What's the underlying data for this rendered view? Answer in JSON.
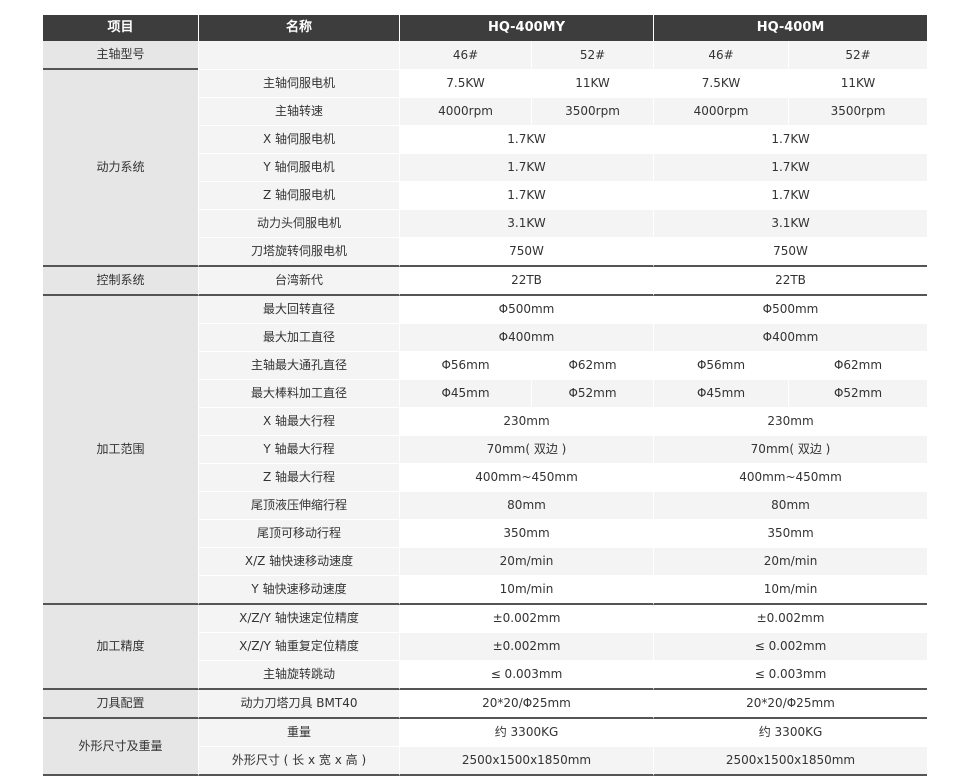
{
  "header": [
    "项目",
    "名称",
    "HQ-400MY",
    "HQ-400M"
  ],
  "spindle_model": {
    "label": "主轴型号",
    "values": [
      "46#",
      "52#",
      "46#",
      "52#"
    ]
  },
  "sections": [
    {
      "category": "动力系统",
      "rows": [
        {
          "name": "主轴伺服电机",
          "values": [
            "7.5KW",
            "11KW",
            "7.5KW",
            "11KW"
          ]
        },
        {
          "name": "主轴转速",
          "values": [
            "4000rpm",
            "3500rpm",
            "4000rpm",
            "3500rpm"
          ]
        },
        {
          "name": "X 轴伺服电机",
          "values": [
            "1.7KW",
            "1.7KW"
          ]
        },
        {
          "name": "Y 轴伺服电机",
          "values": [
            "1.7KW",
            "1.7KW"
          ]
        },
        {
          "name": "Z 轴伺服电机",
          "values": [
            "1.7KW",
            "1.7KW"
          ]
        },
        {
          "name": "动力头伺服电机",
          "values": [
            "3.1KW",
            "3.1KW"
          ]
        },
        {
          "name": "刀塔旋转伺服电机",
          "values": [
            "750W",
            "750W"
          ]
        }
      ]
    },
    {
      "category": "控制系统",
      "rows": [
        {
          "name": "台湾新代",
          "values": [
            "22TB",
            "22TB"
          ]
        }
      ]
    },
    {
      "category": "加工范围",
      "rows": [
        {
          "name": "最大回转直径",
          "values": [
            "Φ500mm",
            "Φ500mm"
          ]
        },
        {
          "name": "最大加工直径",
          "values": [
            "Φ400mm",
            "Φ400mm"
          ]
        },
        {
          "name": "主轴最大通孔直径",
          "values": [
            "Φ56mm",
            "Φ62mm",
            "Φ56mm",
            "Φ62mm"
          ]
        },
        {
          "name": "最大棒料加工直径",
          "values": [
            "Φ45mm",
            "Φ52mm",
            "Φ45mm",
            "Φ52mm"
          ]
        },
        {
          "name": "X 轴最大行程",
          "values": [
            "230mm",
            "230mm"
          ]
        },
        {
          "name": "Y 轴最大行程",
          "values": [
            "70mm( 双边 )",
            "70mm( 双边 )"
          ]
        },
        {
          "name": "Z 轴最大行程",
          "values": [
            "400mm~450mm",
            "400mm~450mm"
          ]
        },
        {
          "name": "尾顶液压伸缩行程",
          "values": [
            "80mm",
            "80mm"
          ]
        },
        {
          "name": "尾顶可移动行程",
          "values": [
            "350mm",
            "350mm"
          ]
        },
        {
          "name": "X/Z 轴快速移动速度",
          "values": [
            "20m/min",
            "20m/min"
          ]
        },
        {
          "name": "Y 轴快速移动速度",
          "values": [
            "10m/min",
            "10m/min"
          ]
        }
      ]
    },
    {
      "category": "加工精度",
      "rows": [
        {
          "name": "X/Z/Y 轴快速定位精度",
          "values": [
            "±0.002mm",
            "±0.002mm"
          ]
        },
        {
          "name": "X/Z/Y 轴重复定位精度",
          "values": [
            "±0.002mm",
            "≤ 0.002mm"
          ]
        },
        {
          "name": "主轴旋转跳动",
          "values": [
            "≤ 0.003mm",
            "≤ 0.003mm"
          ]
        }
      ]
    },
    {
      "category": "刀具配置",
      "rows": [
        {
          "name": "动力刀塔刀具 BMT40",
          "values": [
            "20*20/Φ25mm",
            "20*20/Φ25mm"
          ]
        }
      ]
    },
    {
      "category": "外形尺寸及重量",
      "rows": [
        {
          "name": "重量",
          "values": [
            "约 3300KG",
            "约 3300KG"
          ]
        },
        {
          "name": "外形尺寸 ( 长 x 宽 x 高 )",
          "values": [
            "2500x1500x1850mm",
            "2500x1500x1850mm"
          ]
        }
      ]
    }
  ]
}
